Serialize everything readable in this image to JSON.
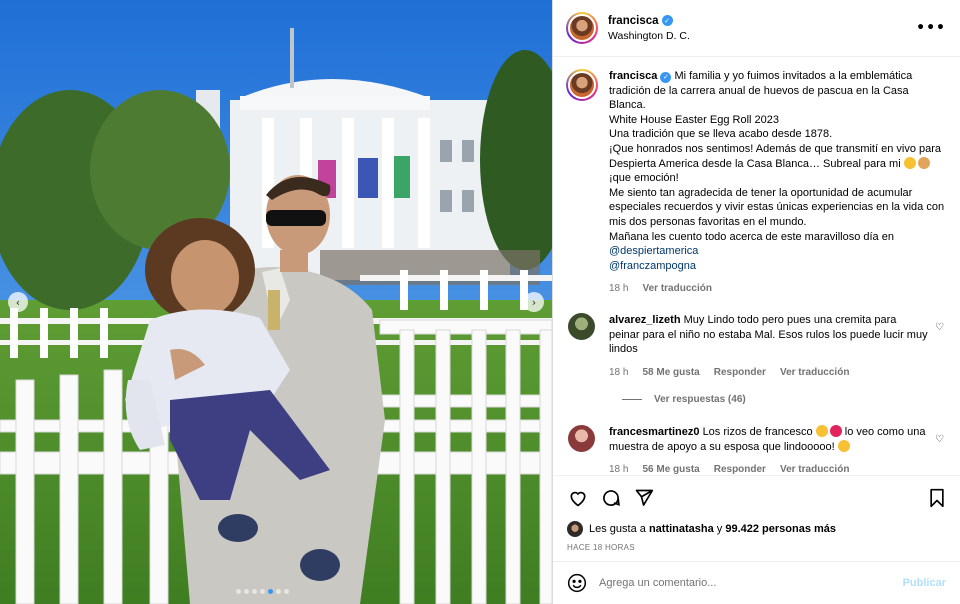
{
  "header": {
    "username": "francisca",
    "location": "Washington D. C.",
    "more_icon": "more-horizontal-icon"
  },
  "caption": {
    "username": "francisca",
    "text_1": "Mi familia y yo fuimos invitados a la emblemática tradición de la carrera anual de huevos de pascua en la Casa Blanca.",
    "text_2": "White House Easter Egg Roll 2023",
    "text_3": "Una tradición que se lleva acabo desde 1878.",
    "text_4": "¡Que honrados nos sentimos! Además de que transmití en vivo para Despierta America desde la Casa Blanca… Subreal para mi",
    "text_5": "¡que emoción!",
    "text_6": "Me siento tan agradecida de tener la oportunidad de acumular especiales recuerdos y vivir estas únicas experiencias en la vida con mis dos personas favoritas en el mundo.",
    "text_7": "Mañana les cuento todo acerca de este maravilloso día en",
    "mention_1": "@despiertamerica",
    "mention_2": "@franczampogna",
    "time": "18 h",
    "translate": "Ver traducción"
  },
  "comments": [
    {
      "username": "alvarez_lizeth",
      "text": "Muy Lindo todo pero pues una cremita para peinar para el niño no estaba Mal. Esos rulos los puede lucir muy lindos",
      "time": "18 h",
      "likes": "58 Me gusta",
      "reply": "Responder",
      "translate": "Ver traducción",
      "view_replies": "Ver respuestas (46)"
    },
    {
      "username": "francesmartinez0",
      "text_a": "Los rizos de francesco",
      "text_b": "lo veo como una muestra de apoyo a su esposa que lindooooo!",
      "time": "18 h",
      "likes": "56 Me gusta",
      "reply": "Responder",
      "translate": "Ver traducción"
    }
  ],
  "actions": {
    "like_icon": "heart-icon",
    "comment_icon": "comment-icon",
    "share_icon": "send-icon",
    "save_icon": "bookmark-icon"
  },
  "likes": {
    "prefix": "Les gusta a",
    "user": "nattinatasha",
    "connector": "y",
    "count": "99.422 personas más"
  },
  "posted": "HACE 18 HORAS",
  "add_comment": {
    "placeholder": "Agrega un comentario...",
    "publish": "Publicar"
  },
  "carousel": {
    "slides": 7,
    "active_slide": 5
  },
  "colors": {
    "link": "#00376b",
    "verified": "#3897f0",
    "publish_disabled": "#b2dffc"
  }
}
